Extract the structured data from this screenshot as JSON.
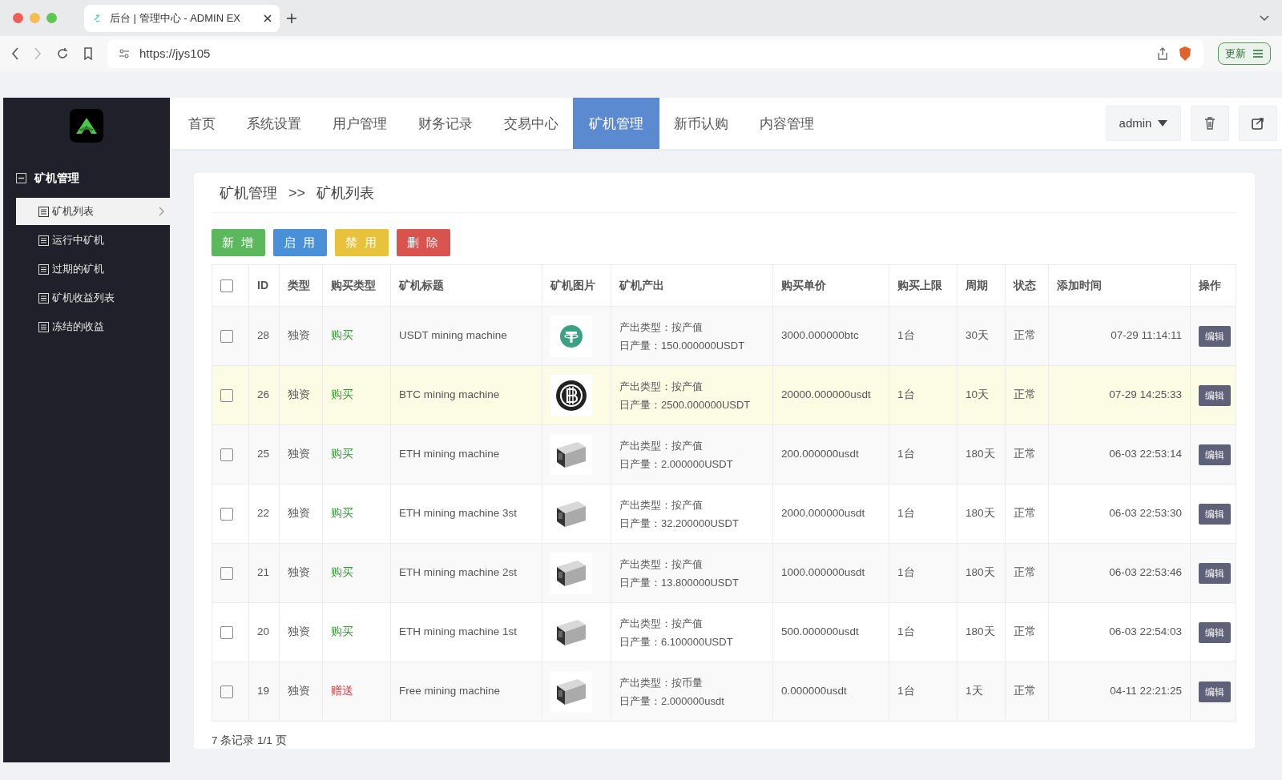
{
  "browser": {
    "tab_title": "后台 | 管理中心 - ADMIN EX",
    "url": "https://jys105",
    "update_button": "更新"
  },
  "top_nav": [
    {
      "label": "首页",
      "selected": false
    },
    {
      "label": "系统设置",
      "selected": false
    },
    {
      "label": "用户管理",
      "selected": false
    },
    {
      "label": "财务记录",
      "selected": false
    },
    {
      "label": "交易中心",
      "selected": false
    },
    {
      "label": "矿机管理",
      "selected": true
    },
    {
      "label": "新币认购",
      "selected": false
    },
    {
      "label": "内容管理",
      "selected": false
    }
  ],
  "user_menu": "admin",
  "sidebar": {
    "group": "矿机管理",
    "expanded": true,
    "items": [
      {
        "label": "矿机列表",
        "selected": true
      },
      {
        "label": "运行中矿机",
        "selected": false
      },
      {
        "label": "过期的矿机",
        "selected": false
      },
      {
        "label": "矿机收益列表",
        "selected": false
      },
      {
        "label": "冻结的收益",
        "selected": false
      }
    ]
  },
  "breadcrumb": [
    "矿机管理",
    ">>",
    "矿机列表"
  ],
  "actions": [
    {
      "label": "新 增",
      "color": "#5cb85c"
    },
    {
      "label": "启 用",
      "color": "#4a90d9"
    },
    {
      "label": "禁 用",
      "color": "#e8c23a"
    },
    {
      "label": "删 除",
      "color": "#d9534f"
    }
  ],
  "table": {
    "columns": [
      "ID",
      "类型",
      "购买类型",
      "矿机标题",
      "矿机图片",
      "矿机产出",
      "购买单价",
      "购买上限",
      "周期",
      "状态",
      "添加时间",
      "操作"
    ],
    "header_checked": false,
    "rows": [
      {
        "checked": false,
        "hovered": false,
        "id": "28",
        "type": "独资",
        "purchase_type": "购买",
        "color": "#3a9a3a",
        "title": "USDT mining machine",
        "kind": "tether",
        "output_type": "产出类型：按产值",
        "daily_output": "日产量：150.000000USDT",
        "price": "3000.000000btc",
        "limit": "1台",
        "period": "30天",
        "status": "正常",
        "added": "07-29 11:14:11",
        "action": "编辑"
      },
      {
        "checked": false,
        "hovered": true,
        "id": "26",
        "type": "独资",
        "purchase_type": "购买",
        "color": "#3a9a3a",
        "title": "BTC mining machine",
        "kind": "bitcoin",
        "output_type": "产出类型：按产值",
        "daily_output": "日产量：2500.000000USDT",
        "price": "20000.000000usdt",
        "limit": "1台",
        "period": "10天",
        "status": "正常",
        "added": "07-29 14:25:33",
        "action": "编辑"
      },
      {
        "checked": false,
        "hovered": false,
        "id": "25",
        "type": "独资",
        "purchase_type": "购买",
        "color": "#3a9a3a",
        "title": "ETH mining machine",
        "kind": "miner",
        "output_type": "产出类型：按产值",
        "daily_output": "日产量：2.000000USDT",
        "price": "200.000000usdt",
        "limit": "1台",
        "period": "180天",
        "status": "正常",
        "added": "06-03 22:53:14",
        "action": "编辑"
      },
      {
        "checked": false,
        "hovered": false,
        "id": "22",
        "type": "独资",
        "purchase_type": "购买",
        "color": "#3a9a3a",
        "title": "ETH mining machine 3st",
        "kind": "miner",
        "output_type": "产出类型：按产值",
        "daily_output": "日产量：32.200000USDT",
        "price": "2000.000000usdt",
        "limit": "1台",
        "period": "180天",
        "status": "正常",
        "added": "06-03 22:53:30",
        "action": "编辑"
      },
      {
        "checked": false,
        "hovered": false,
        "id": "21",
        "type": "独资",
        "purchase_type": "购买",
        "color": "#3a9a3a",
        "title": "ETH mining machine 2st",
        "kind": "miner",
        "output_type": "产出类型：按产值",
        "daily_output": "日产量：13.800000USDT",
        "price": "1000.000000usdt",
        "limit": "1台",
        "period": "180天",
        "status": "正常",
        "added": "06-03 22:53:46",
        "action": "编辑"
      },
      {
        "checked": false,
        "hovered": false,
        "id": "20",
        "type": "独资",
        "purchase_type": "购买",
        "color": "#3a9a3a",
        "title": "ETH mining machine 1st",
        "kind": "miner",
        "output_type": "产出类型：按产值",
        "daily_output": "日产量：6.100000USDT",
        "price": "500.000000usdt",
        "limit": "1台",
        "period": "180天",
        "status": "正常",
        "added": "06-03 22:54:03",
        "action": "编辑"
      },
      {
        "checked": false,
        "hovered": false,
        "id": "19",
        "type": "独资",
        "purchase_type": "赠送",
        "color": "#e03a3a",
        "title": "Free mining machine",
        "kind": "miner",
        "output_type": "产出类型：按币量",
        "daily_output": "日产量：2.000000usdt",
        "price": "0.000000usdt",
        "limit": "1台",
        "period": "1天",
        "status": "正常",
        "added": "04-11 22:21:25",
        "action": "编辑"
      }
    ]
  },
  "footer": "7 条记录 1/1 页"
}
